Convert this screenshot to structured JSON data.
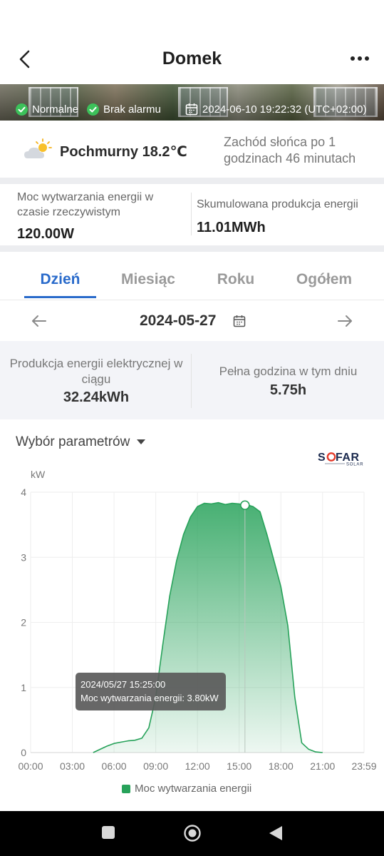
{
  "header": {
    "title": "Domek"
  },
  "status": {
    "normal_label": "Normalne",
    "alarm_label": "Brak alarmu",
    "datetime": "2024-06-10 19:22:32 (UTC+02:00)"
  },
  "weather": {
    "description": "Pochmurny 18.2℃",
    "sunset": "Zachód słońca po 1 godzinach 46 minutach"
  },
  "metrics": {
    "realtime_label": "Moc wytwarzania energii w czasie rzeczywistym",
    "realtime_value": "120.00W",
    "cumulative_label": "Skumulowana produkcja energii",
    "cumulative_value": "11.01MWh"
  },
  "tabs": [
    {
      "label": "Dzień",
      "active": true
    },
    {
      "label": "Miesiąc",
      "active": false
    },
    {
      "label": "Roku",
      "active": false
    },
    {
      "label": "Ogółem",
      "active": false
    }
  ],
  "date_nav": {
    "date": "2024-05-27"
  },
  "summary": {
    "production_label": "Produkcja energii elektrycznej w ciągu",
    "production_value": "32.24kWh",
    "full_hours_label": "Pełna godzina w tym dniu",
    "full_hours_value": "5.75h"
  },
  "chart_controls": {
    "param_select": "Wybór parametrów"
  },
  "logo_text": "SOFAR SOLAR",
  "colors": {
    "accent": "#2a6bcb",
    "series": "#27a25a",
    "status_ok": "#3cc15a"
  },
  "chart_data": {
    "type": "area",
    "ylabel": "kW",
    "ylim": [
      0,
      4
    ],
    "yticks": [
      "0",
      "1",
      "2",
      "3",
      "4"
    ],
    "xticks": [
      "00:00",
      "03:00",
      "06:00",
      "09:00",
      "12:00",
      "15:00",
      "18:00",
      "21:00",
      "23:59"
    ],
    "grid": true,
    "legend_position": "bottom",
    "series": [
      {
        "name": "Moc wytwarzania energii",
        "x": [
          "04:30",
          "05:00",
          "05:30",
          "06:00",
          "06:30",
          "07:00",
          "07:30",
          "08:00",
          "08:30",
          "09:00",
          "09:30",
          "10:00",
          "10:30",
          "11:00",
          "11:30",
          "12:00",
          "12:30",
          "13:00",
          "13:30",
          "14:00",
          "14:30",
          "15:00",
          "15:25",
          "15:30",
          "16:00",
          "16:30",
          "17:00",
          "17:30",
          "18:00",
          "18:30",
          "19:00",
          "19:30",
          "20:00",
          "20:30",
          "21:00"
        ],
        "y": [
          0.0,
          0.05,
          0.1,
          0.14,
          0.16,
          0.18,
          0.19,
          0.22,
          0.38,
          0.85,
          1.65,
          2.4,
          2.95,
          3.35,
          3.62,
          3.78,
          3.83,
          3.82,
          3.84,
          3.81,
          3.83,
          3.82,
          3.8,
          3.81,
          3.78,
          3.7,
          3.35,
          2.95,
          2.55,
          1.95,
          0.85,
          0.15,
          0.05,
          0.01,
          0.0
        ]
      }
    ],
    "tooltip": {
      "time": "2024/05/27 15:25:00",
      "text": "Moc wytwarzania energii: 3.80kW"
    }
  }
}
